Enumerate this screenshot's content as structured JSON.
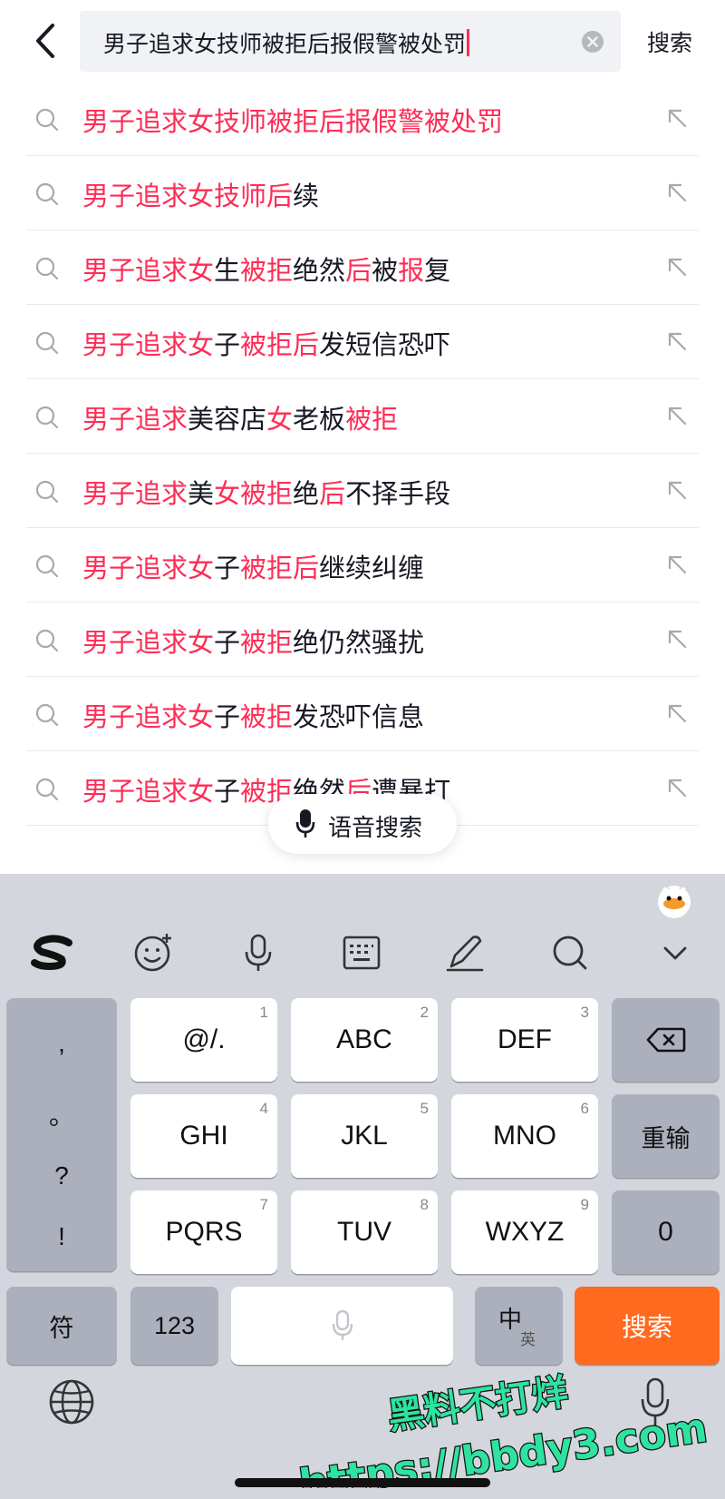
{
  "header": {
    "query": "男子追求女技师被拒后报假警被处罚",
    "search_button": "搜索"
  },
  "suggestions": [
    {
      "segments": [
        {
          "t": "男子追求女技师被拒后报假警被处罚",
          "h": true
        }
      ]
    },
    {
      "segments": [
        {
          "t": "男子追求女技师后",
          "h": true
        },
        {
          "t": "续",
          "h": false
        }
      ]
    },
    {
      "segments": [
        {
          "t": "男子追求女",
          "h": true
        },
        {
          "t": "生",
          "h": false
        },
        {
          "t": "被拒",
          "h": true
        },
        {
          "t": "绝然",
          "h": false
        },
        {
          "t": "后",
          "h": true
        },
        {
          "t": "被",
          "h": false
        },
        {
          "t": "报",
          "h": true
        },
        {
          "t": "复",
          "h": false
        }
      ]
    },
    {
      "segments": [
        {
          "t": "男子追求女",
          "h": true
        },
        {
          "t": "子",
          "h": false
        },
        {
          "t": "被拒后",
          "h": true
        },
        {
          "t": "发短信恐吓",
          "h": false
        }
      ]
    },
    {
      "segments": [
        {
          "t": "男子追求",
          "h": true
        },
        {
          "t": "美容店",
          "h": false
        },
        {
          "t": "女",
          "h": true
        },
        {
          "t": "老板",
          "h": false
        },
        {
          "t": "被拒",
          "h": true
        }
      ]
    },
    {
      "segments": [
        {
          "t": "男子追求",
          "h": true
        },
        {
          "t": "美",
          "h": false
        },
        {
          "t": "女被拒",
          "h": true
        },
        {
          "t": "绝",
          "h": false
        },
        {
          "t": "后",
          "h": true
        },
        {
          "t": "不择手段",
          "h": false
        }
      ]
    },
    {
      "segments": [
        {
          "t": "男子追求女",
          "h": true
        },
        {
          "t": "子",
          "h": false
        },
        {
          "t": "被拒后",
          "h": true
        },
        {
          "t": "继续纠缠",
          "h": false
        }
      ]
    },
    {
      "segments": [
        {
          "t": "男子追求女",
          "h": true
        },
        {
          "t": "子",
          "h": false
        },
        {
          "t": "被拒",
          "h": true
        },
        {
          "t": "绝仍然骚扰",
          "h": false
        }
      ]
    },
    {
      "segments": [
        {
          "t": "男子追求女",
          "h": true
        },
        {
          "t": "子",
          "h": false
        },
        {
          "t": "被拒",
          "h": true
        },
        {
          "t": "发恐吓信息",
          "h": false
        }
      ]
    },
    {
      "segments": [
        {
          "t": "男子追求女",
          "h": true
        },
        {
          "t": "子",
          "h": false
        },
        {
          "t": "被拒",
          "h": true
        },
        {
          "t": "绝然",
          "h": false
        },
        {
          "t": "后",
          "h": true
        },
        {
          "t": "遭暴打",
          "h": false
        }
      ]
    }
  ],
  "voice_search": "语音搜索",
  "keyboard": {
    "punctuation": [
      ",",
      "。",
      "?",
      "!"
    ],
    "keys": [
      {
        "label": "@/.",
        "num": "1"
      },
      {
        "label": "ABC",
        "num": "2"
      },
      {
        "label": "DEF",
        "num": "3"
      },
      {
        "label": "GHI",
        "num": "4"
      },
      {
        "label": "JKL",
        "num": "5"
      },
      {
        "label": "MNO",
        "num": "6"
      },
      {
        "label": "PQRS",
        "num": "7"
      },
      {
        "label": "TUV",
        "num": "8"
      },
      {
        "label": "WXYZ",
        "num": "9"
      }
    ],
    "retype": "重输",
    "zero": "0",
    "symbols": "符",
    "numbers": "123",
    "lang_main": "中",
    "lang_alt": "英",
    "search": "搜索"
  },
  "watermark": {
    "line1": "黑料不打烊",
    "line2": "https://bbdy3.com"
  },
  "colors": {
    "highlight": "#fe2c55",
    "search_key": "#ff6a1f",
    "watermark": "#2ee3a0"
  }
}
